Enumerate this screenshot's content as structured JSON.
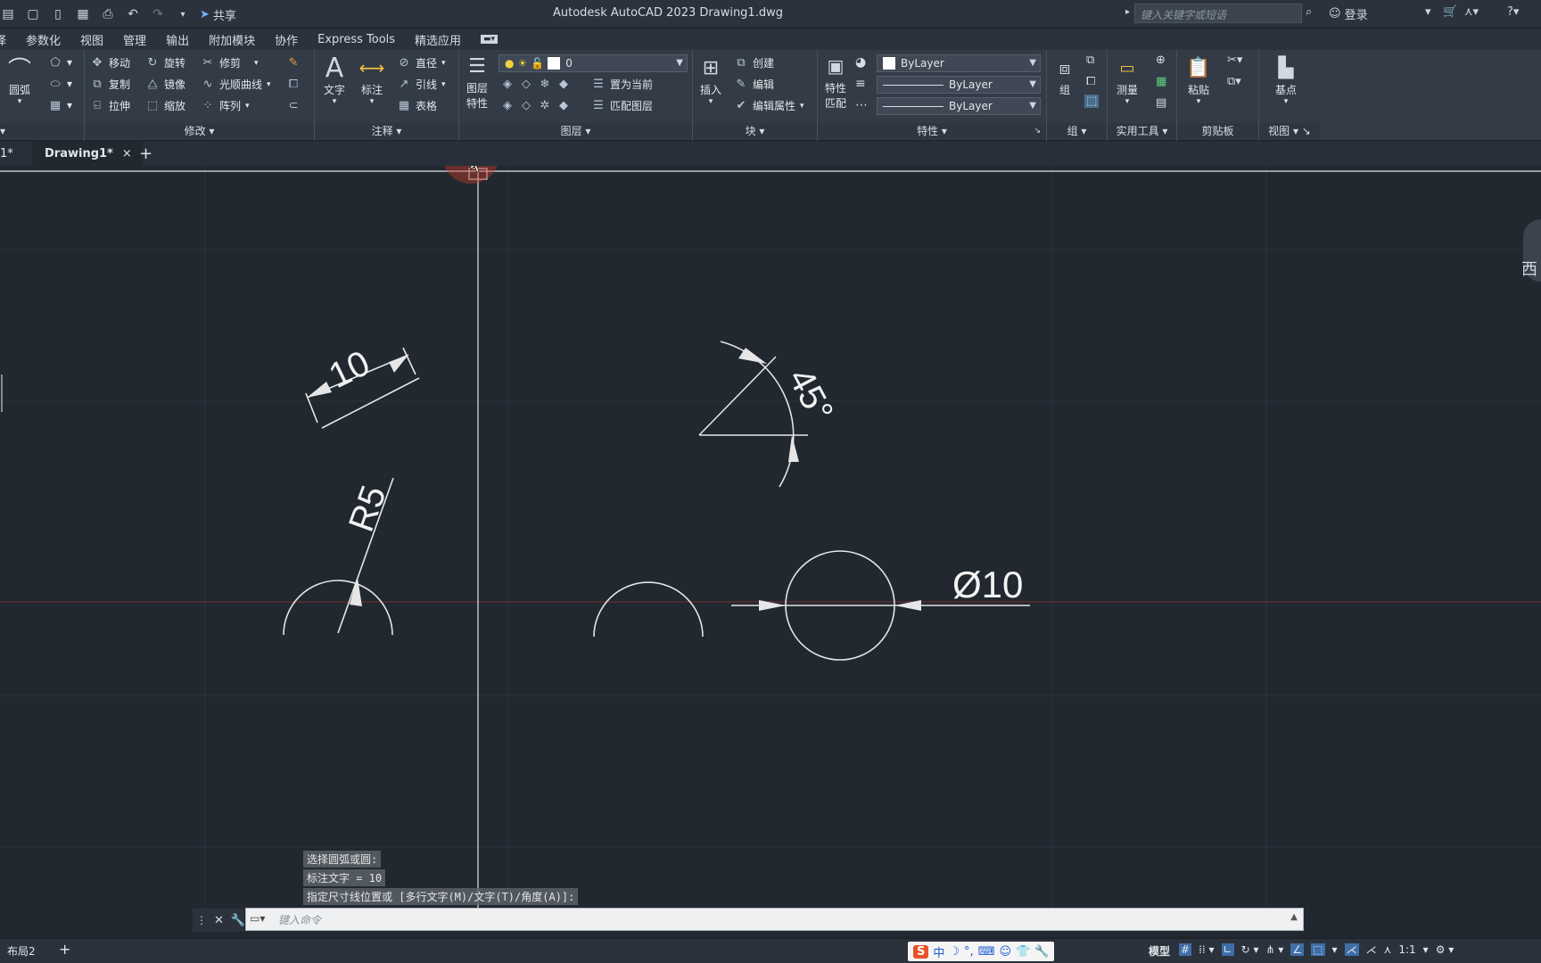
{
  "titlebar": {
    "share": "共享",
    "title": "Autodesk AutoCAD 2023    Drawing1.dwg",
    "search_placeholder": "键入关键字或短语",
    "login": "登录"
  },
  "menu": [
    "译",
    "参数化",
    "视图",
    "管理",
    "输出",
    "附加模块",
    "协作",
    "Express Tools",
    "精选应用"
  ],
  "ribbon": {
    "draw": {
      "arc": "圆弧"
    },
    "modify": {
      "label": "修改",
      "move": "移动",
      "rotate": "旋转",
      "trim": "修剪",
      "copy": "复制",
      "mirror": "镜像",
      "spline": "光顺曲线",
      "stretch": "拉伸",
      "scale": "缩放",
      "array": "阵列"
    },
    "annotation": {
      "label": "注释",
      "text": "文字",
      "dim": "标注",
      "diameter": "直径",
      "leader": "引线",
      "table": "表格"
    },
    "layers": {
      "label": "图层",
      "props": "图层\n特性",
      "props1": "图层",
      "props2": "特性",
      "current_layer": "0",
      "set_current": "置为当前",
      "match": "匹配图层"
    },
    "block": {
      "label": "块",
      "insert": "插入",
      "create": "创建",
      "edit": "编辑",
      "edit_attr": "编辑属性"
    },
    "properties": {
      "label": "特性",
      "match1": "特性",
      "match2": "匹配",
      "color": "ByLayer",
      "linetype": "ByLayer",
      "lineweight": "ByLayer"
    },
    "group": {
      "label": "组",
      "group": "组"
    },
    "utilities": {
      "label": "实用工具",
      "measure": "测量"
    },
    "clipboard": {
      "label": "剪贴板",
      "paste": "粘贴"
    },
    "view": {
      "label": "视图",
      "base": "基点"
    }
  },
  "tabs": {
    "prev": "1*",
    "active": "Drawing1*",
    "close": "×",
    "add": "+"
  },
  "drawing": {
    "dim_linear": "10",
    "dim_angle": "45°",
    "dim_radius": "R5",
    "dim_diameter": "Ø10",
    "viewcube_label": "西"
  },
  "command": {
    "history": [
      "选择圆弧或圆:",
      "标注文字 = 10",
      "指定尺寸线位置或 [多行文字(M)/文字(T)/角度(A)]:"
    ],
    "placeholder": "键入命令"
  },
  "status": {
    "layout": "布局2",
    "add": "+",
    "model": "模型",
    "scale": "1:1"
  },
  "ime": {
    "mode": "中"
  }
}
